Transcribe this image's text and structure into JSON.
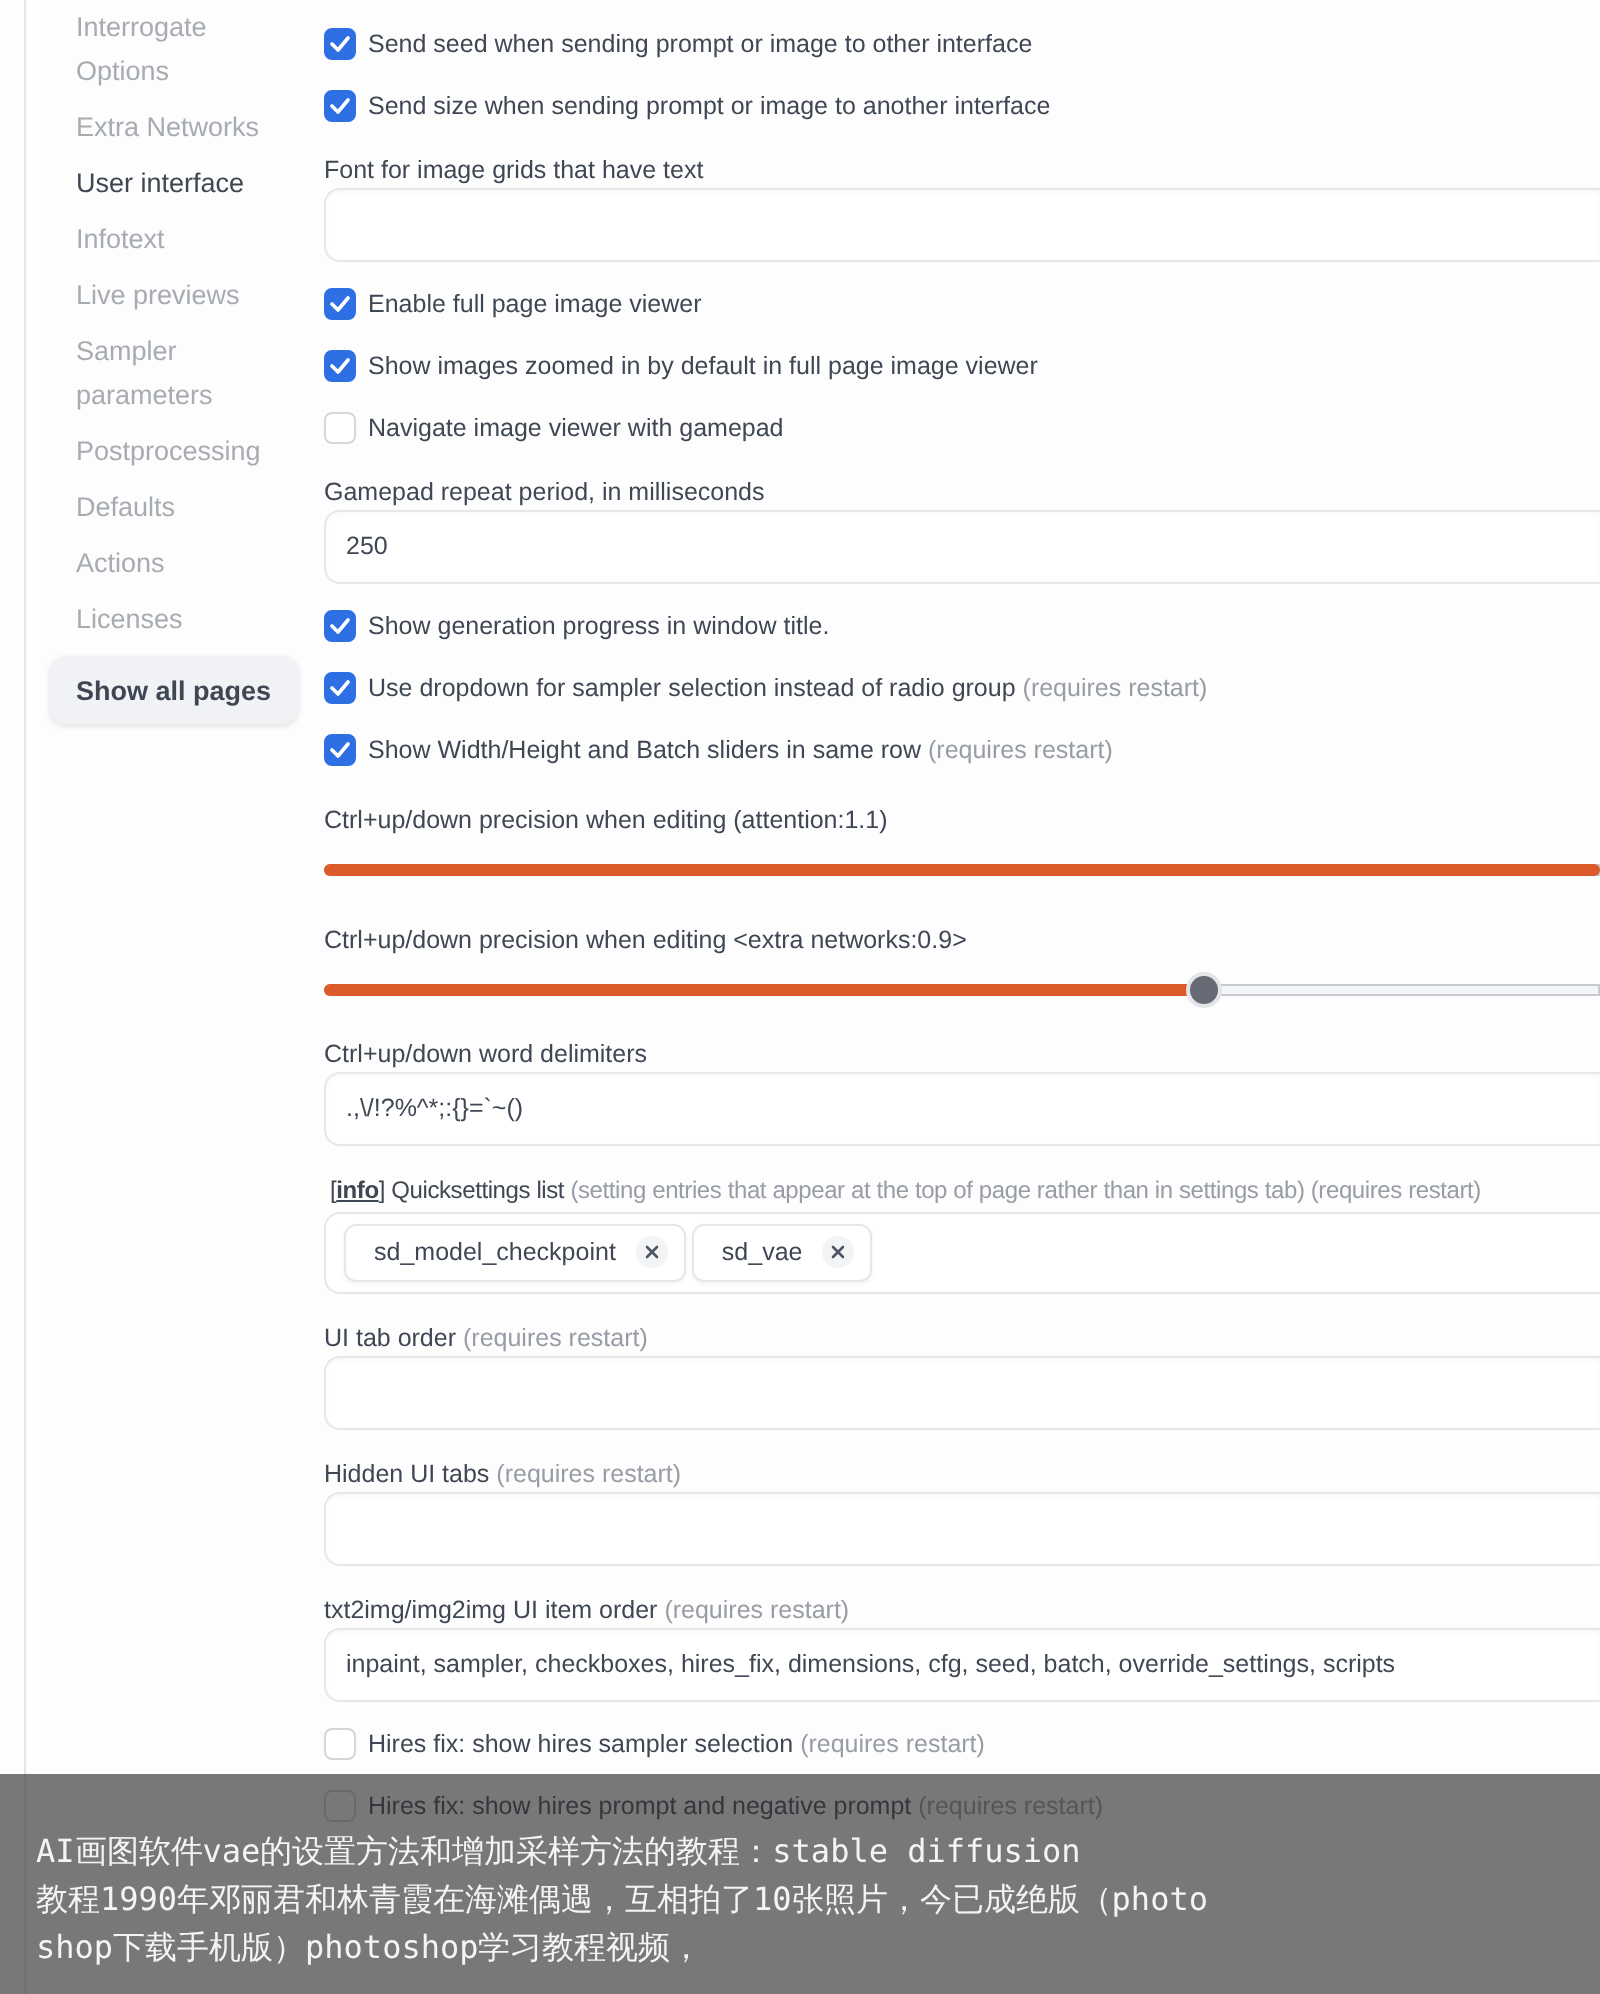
{
  "sidebar": {
    "items": [
      {
        "label": "Interrogate Options",
        "selected": false
      },
      {
        "label": "Extra Networks",
        "selected": false
      },
      {
        "label": "User interface",
        "selected": true
      },
      {
        "label": "Infotext",
        "selected": false
      },
      {
        "label": "Live previews",
        "selected": false
      },
      {
        "label": "Sampler parameters",
        "selected": false
      },
      {
        "label": "Postprocessing",
        "selected": false
      },
      {
        "label": "Defaults",
        "selected": false
      },
      {
        "label": "Actions",
        "selected": false
      },
      {
        "label": "Licenses",
        "selected": false
      }
    ],
    "show_all_button": "Show all pages"
  },
  "settings": [
    {
      "kind": "checkbox",
      "label": "Send seed when sending prompt or image to other interface",
      "checked": true
    },
    {
      "kind": "checkbox",
      "label": "Send size when sending prompt or image to another interface",
      "checked": true
    },
    {
      "kind": "textbox",
      "label": "Font for image grids that have text"
    },
    {
      "kind": "checkbox",
      "label": "Enable full page image viewer",
      "checked": true
    },
    {
      "kind": "checkbox",
      "label": "Show images zoomed in by default in full page image viewer",
      "checked": true
    },
    {
      "kind": "checkbox",
      "label": "Navigate image viewer with gamepad",
      "checked": false
    },
    {
      "kind": "textbox",
      "label": "Gamepad repeat period, in milliseconds",
      "value": "250"
    },
    {
      "kind": "checkbox",
      "label": "Show generation progress in window title.",
      "checked": true
    },
    {
      "kind": "checkbox",
      "label": "Use dropdown for sampler selection instead of radio group",
      "note": "(requires restart)",
      "checked": true
    },
    {
      "kind": "checkbox",
      "label": "Show Width/Height and Batch sliders in same row",
      "note": "(requires restart)",
      "checked": true
    },
    {
      "kind": "slider",
      "label": "Ctrl+up/down precision when editing (attention:1.1)",
      "level": 1
    },
    {
      "kind": "slider",
      "label": "Ctrl+up/down precision when editing <extra networks:0.9>",
      "level": 0.69
    },
    {
      "kind": "textbox",
      "label": "Ctrl+up/down word delimiters",
      "value": ".,\\/!?%^*;:{}=`~()"
    },
    {
      "kind": "multiselect",
      "link": {
        "open": "[",
        "text": "info",
        "close": "]"
      },
      "label": "Quicksettings list",
      "note": "(setting entries that appear at the top of page rather than in settings tab) (requires restart)",
      "chips": [
        "sd_model_checkpoint",
        "sd_vae"
      ]
    },
    {
      "kind": "textbox",
      "label": "UI tab order",
      "note": "(requires restart)"
    },
    {
      "kind": "textbox",
      "label": "Hidden UI tabs",
      "note": "(requires restart)"
    },
    {
      "kind": "textbox",
      "label": "txt2img/img2img UI item order",
      "note": "(requires restart)",
      "value": "inpaint, sampler, checkboxes, hires_fix, dimensions, cfg, seed, batch, override_settings, scripts"
    },
    {
      "kind": "checkbox",
      "label": "Hires fix: show hires sampler selection",
      "note": "(requires restart)",
      "checked": false
    },
    {
      "kind": "checkbox",
      "label": "Hires fix: show hires prompt and negative prompt",
      "note": "(requires restart)",
      "checked": false
    }
  ],
  "caption_overlay": {
    "text": "AI画图软件vae的设置方法和增加采样方法的教程：stable diffusion\n教程1990年邓丽君和林青霞在海滩偶遇，互相拍了10张照片，今已成绝版（photo\nshop下载手机版）photoshop学习教程视频，"
  }
}
